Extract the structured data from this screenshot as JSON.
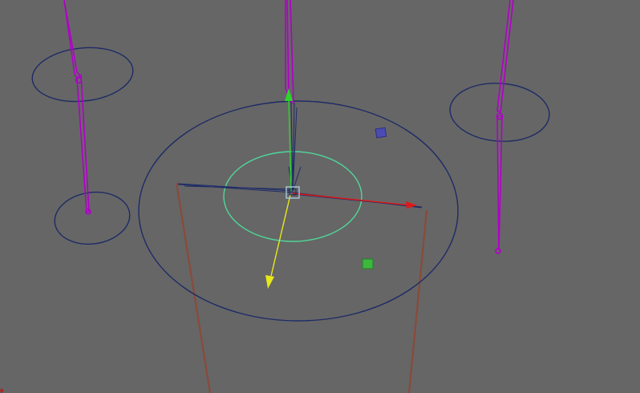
{
  "viewport": {
    "background": "#666666",
    "colors": {
      "bone": "#b100c8",
      "control_curve": "#1d2b66",
      "inner_curve": "#4fd79a",
      "axis_x": "#e01818",
      "axis_y": "#2bd52b",
      "axis_z": "#e8e81a",
      "leg_bone": "#8a4a3a",
      "pivot": "#a9c9d9",
      "locator_blue": "#4b4bb3",
      "locator_green": "#3cb83c",
      "origin_marker": "#cc1010"
    },
    "objects": [
      {
        "name": "left-upper-ring",
        "type": "nurbs-circle"
      },
      {
        "name": "left-lower-ring",
        "type": "nurbs-circle"
      },
      {
        "name": "right-ring",
        "type": "nurbs-circle"
      },
      {
        "name": "main-control-ring",
        "type": "nurbs-circle"
      },
      {
        "name": "inner-ring",
        "type": "nurbs-circle",
        "selected": true
      },
      {
        "name": "transform-manipulator",
        "type": "move-tool"
      }
    ]
  }
}
